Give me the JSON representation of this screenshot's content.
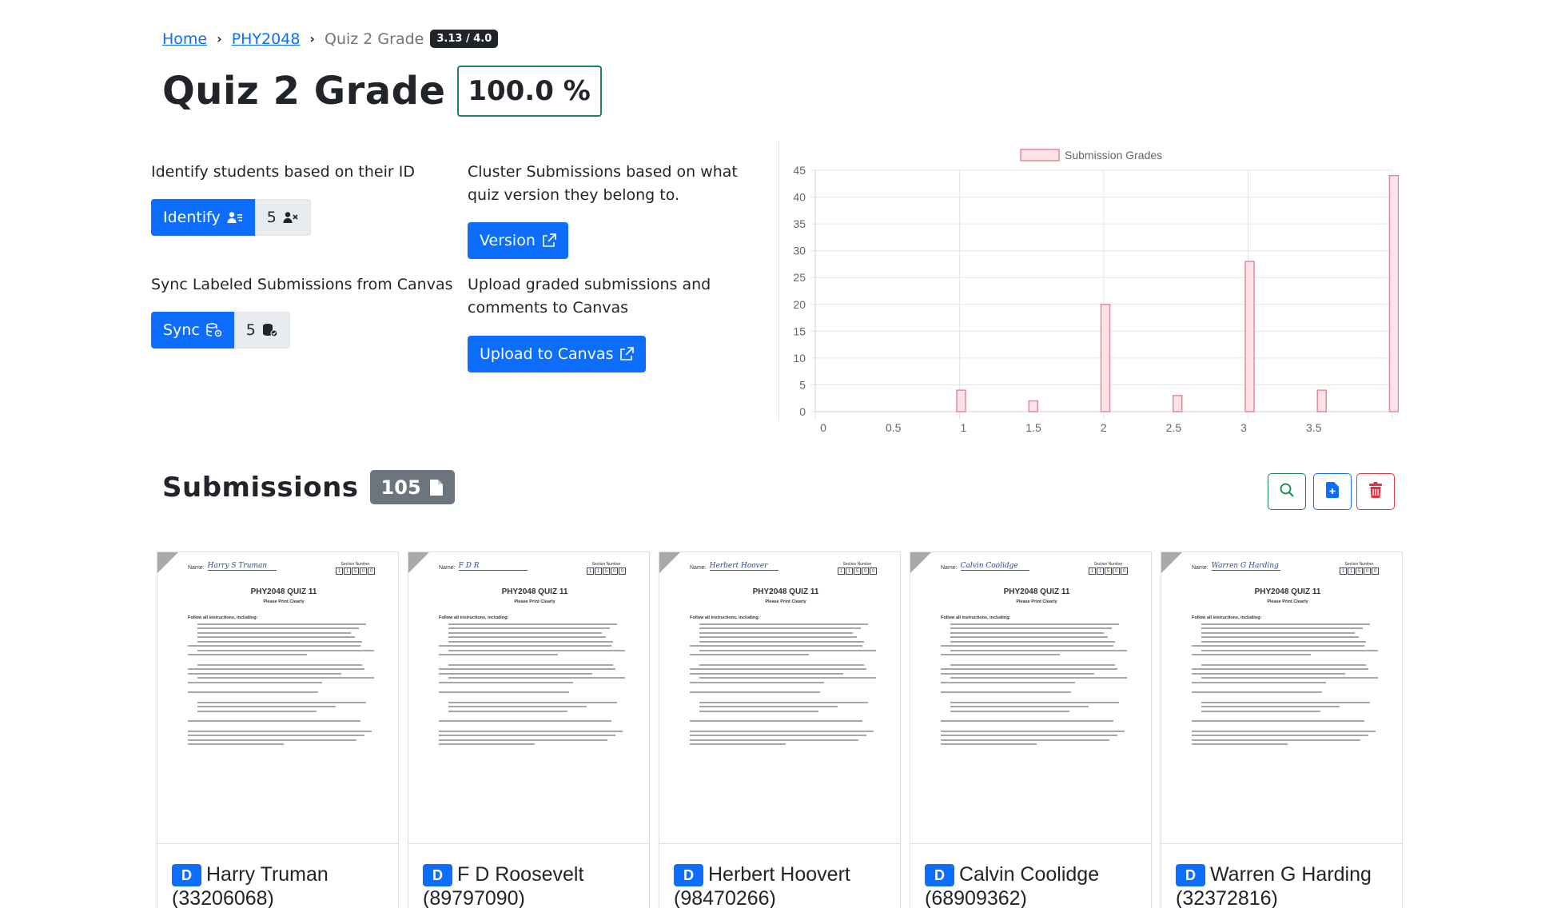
{
  "breadcrumb": {
    "home": "Home",
    "course": "PHY2048",
    "current": "Quiz 2 Grade",
    "gpa": "3.13 / 4.0"
  },
  "page": {
    "title": "Quiz 2 Grade",
    "grade": "100.0 %"
  },
  "actions": {
    "identify_text": "Identify students based on their ID",
    "identify_label": "Identify",
    "identify_count": "5",
    "sync_text": "Sync Labeled Submissions from Canvas",
    "sync_label": "Sync",
    "sync_count": "5",
    "version_text": "Cluster Submissions based on what quiz version they belong to.",
    "version_label": "Version",
    "upload_text": "Upload graded submissions and comments to Canvas",
    "upload_label": "Upload to Canvas"
  },
  "chart_data": {
    "type": "bar",
    "legend": [
      "Submission Grades"
    ],
    "legend_position": "top",
    "x": [
      1,
      1.5,
      2,
      2.5,
      3,
      3.5,
      4
    ],
    "values": [
      4,
      2,
      20,
      3,
      28,
      4,
      44
    ],
    "xticks": [
      "0",
      "0.5",
      "1",
      "1.5",
      "2",
      "2.5",
      "3",
      "3.5"
    ],
    "yticks": [
      "0",
      "5",
      "10",
      "15",
      "20",
      "25",
      "30",
      "35",
      "40",
      "45"
    ],
    "xlim": [
      0,
      4
    ],
    "ylim": [
      0,
      45
    ],
    "grid": true,
    "colors": {
      "bar_fill": "#fbe3e8",
      "bar_stroke": "#e58a9c"
    }
  },
  "submissions": {
    "title": "Submissions",
    "count": "105",
    "cards": [
      {
        "badge": "D",
        "name": "Harry Truman",
        "id": "(33206068)",
        "handwriting": "Harry S Truman"
      },
      {
        "badge": "D",
        "name": "F D Roosevelt",
        "id": "(89797090)",
        "handwriting": "F D R"
      },
      {
        "badge": "D",
        "name": "Herbert Hoovert",
        "id": "(98470266)",
        "handwriting": "Herbert Hoover"
      },
      {
        "badge": "D",
        "name": "Calvin Coolidge",
        "id": "(68909362)",
        "handwriting": "Calvin Coolidge"
      },
      {
        "badge": "D",
        "name": "Warren G Harding",
        "id": "(32372816)",
        "handwriting": "Warren G Harding"
      }
    ]
  },
  "quiz_doc": {
    "name_label": "Name:",
    "section_label": "Section Number",
    "section_digits": [
      "1",
      "1",
      "5",
      "0",
      "0"
    ],
    "heading": "PHY2048 QUIZ 11",
    "subheading": "Please Print Clearly",
    "instructions": "Follow all instructions, including:"
  },
  "icons": {
    "identify": "person-lines-icon",
    "identify_count": "person-x-icon",
    "sync": "database-gear-icon",
    "sync_count": "database-check-icon",
    "external": "box-arrow-up-right-icon",
    "file": "file-icon",
    "search": "search-icon",
    "add": "file-plus-icon",
    "delete": "trash-icon"
  }
}
